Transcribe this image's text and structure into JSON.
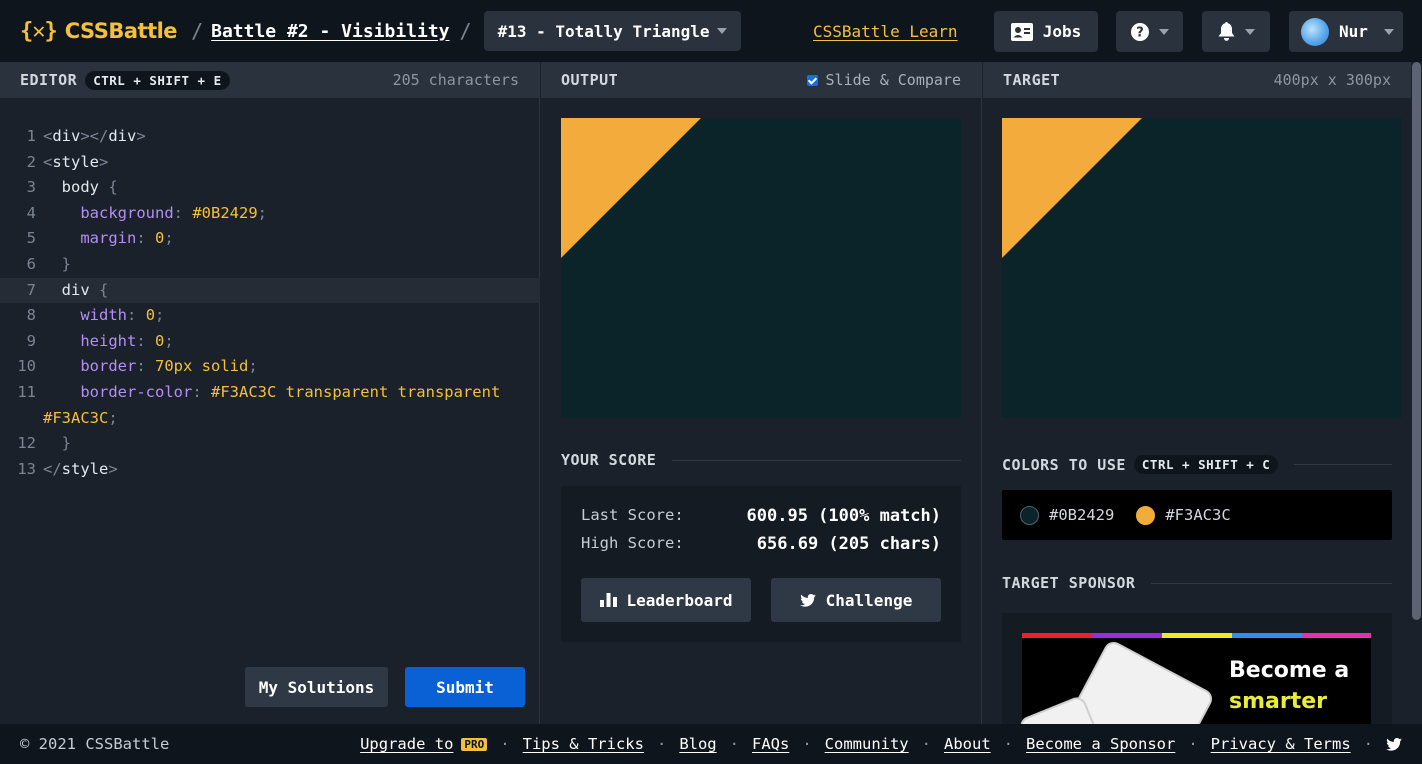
{
  "header": {
    "logo_mark": "{✕}",
    "logo_text": "CSSBattle",
    "sep1": "/",
    "battle_title": "Battle #2 - Visibility",
    "sep2": "/",
    "target_select": "#13 - Totally Triangle",
    "learn_link": "CSSBattle Learn",
    "jobs_label": "Jobs",
    "user_name": "Nur"
  },
  "editor": {
    "title": "EDITOR",
    "shortcut": "CTRL + SHIFT + E",
    "char_count": "205 characters",
    "lines": [
      {
        "n": "1",
        "text": "<div></div>"
      },
      {
        "n": "2",
        "text": "<style>"
      },
      {
        "n": "3",
        "text": "  body {"
      },
      {
        "n": "4",
        "text": "    background: #0B2429;"
      },
      {
        "n": "5",
        "text": "    margin: 0;"
      },
      {
        "n": "6",
        "text": "  }"
      },
      {
        "n": "7",
        "text": "  div {"
      },
      {
        "n": "8",
        "text": "    width: 0;"
      },
      {
        "n": "9",
        "text": "    height: 0;"
      },
      {
        "n": "10",
        "text": "    border: 70px solid;"
      },
      {
        "n": "11",
        "text": "    border-color: #F3AC3C transparent transparent"
      },
      {
        "n": "",
        "text": "#F3AC3C;"
      },
      {
        "n": "12",
        "text": "  }"
      },
      {
        "n": "13",
        "text": "</style>"
      }
    ],
    "solutions_label": "My Solutions",
    "submit_label": "Submit"
  },
  "output": {
    "title": "OUTPUT",
    "slide_label": "Slide & Compare",
    "slide_checked": true,
    "score_title": "YOUR SCORE",
    "last_label": "Last Score:",
    "last_value": "600.95 (100% match)",
    "high_label": "High Score:",
    "high_value": "656.69 (205 chars)",
    "leaderboard_label": "Leaderboard",
    "challenge_label": "Challenge"
  },
  "target": {
    "title": "TARGET",
    "dims": "400px x 300px",
    "colors_title": "COLORS TO USE",
    "colors_shortcut": "CTRL + SHIFT + C",
    "colors": [
      {
        "hex": "#0B2429"
      },
      {
        "hex": "#F3AC3C"
      }
    ],
    "sponsor_title": "TARGET SPONSOR",
    "sponsor_line1": "Become a",
    "sponsor_line2": "smarter"
  },
  "footer": {
    "copyright": "© 2021 CSSBattle",
    "upgrade": "Upgrade to",
    "pro": "PRO",
    "links": [
      "Tips & Tricks",
      "Blog",
      "FAQs",
      "Community",
      "About",
      "Become a Sponsor",
      "Privacy & Terms"
    ]
  },
  "colors": {
    "accent": "#f3c03b",
    "background_canvas": "#0B2429",
    "triangle": "#F3AC3C",
    "submit": "#0a61d6"
  }
}
